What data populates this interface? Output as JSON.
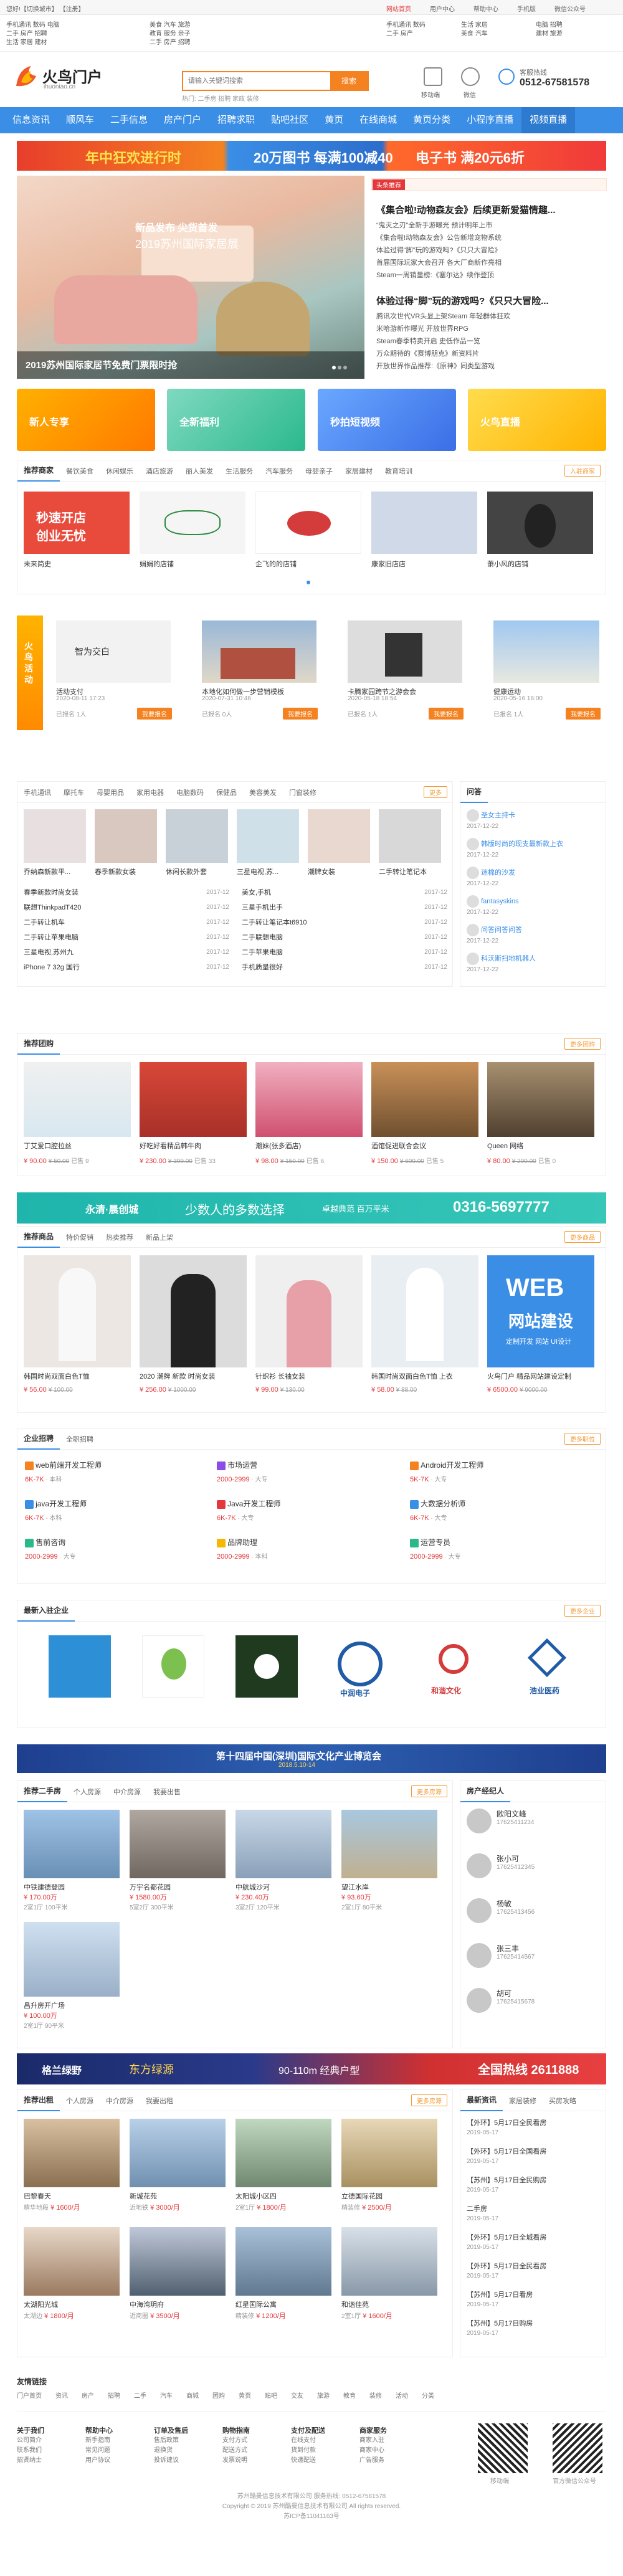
{
  "topbar": {
    "left": "您好!【切换城市】  【注册】",
    "right": [
      "网站首页",
      "用户中心",
      "帮助中心",
      "手机版",
      "微信公众号"
    ]
  },
  "header": {
    "cats": [
      [
        "手机通讯",
        "数码",
        "电脑"
      ],
      [
        "二手",
        "房产",
        "招聘"
      ],
      [
        "生活",
        "家居",
        "建材"
      ],
      [
        "美食",
        "汽车",
        "旅游"
      ],
      [
        "教育",
        "服务",
        "亲子"
      ]
    ],
    "cats2": [
      [
        "手机通讯",
        "数码",
        "电脑"
      ],
      [
        "二手",
        "房产",
        "招聘"
      ],
      [
        "生活",
        "家居",
        "建材"
      ],
      [
        "美食",
        "汽车",
        "旅游"
      ]
    ],
    "logo_text": "火鸟门户",
    "logo_sub": "ihuoniao.cn",
    "search_placeholder": "请输入关键词搜索",
    "search_button": "搜索",
    "search_tags": [
      "门店信息",
      "新闻公告",
      "招聘求职"
    ],
    "hot_words": "热门: 二手房 招聘 家政 装修",
    "icon_labels": [
      "移动端",
      "微信"
    ],
    "hotline_label": "客服热线",
    "hotline": "0512-67581578"
  },
  "nav": [
    "信息资讯",
    "顺风车",
    "二手信息",
    "房产门户",
    "招聘求职",
    "贴吧社区",
    "黄页",
    "在线商城",
    "黄页分类",
    "小程序直播",
    "视频直播"
  ],
  "banner": {
    "left": "年中狂欢进行时",
    "mid": "20万图书 每满100减40",
    "right": "电子书 满20元6折"
  },
  "hero": {
    "title": "2019苏州国际家居节免费门票限时抢",
    "sub": "2019苏州国际家居展",
    "ad": "新品发布 尖货首发"
  },
  "news": {
    "badge": "头条推荐",
    "headline": "《集合啦!动物森友会》后续更新爱猫情趣...",
    "lines": [
      "“鬼灭之刃”全新手游曝光 预计明年上市",
      "《集合啦!动物森友会》公告新增宠物系统",
      "体验过得“脚”玩的游戏吗?《只只大冒险》",
      "首届国际玩家大会召开 各大厂商新作亮相",
      "Steam一周销量榜:《塞尔达》续作登顶"
    ],
    "headline2": "体验过得“脚”玩的游戏吗?《只只大冒险...",
    "lines2": [
      "腾讯次世代VR头显上架Steam 年轻群体狂欢",
      "米哈游新作曝光 开放世界RPG",
      "Steam春季特卖开启 史低作品一览",
      "万众期待的《赛博朋克》新资料片",
      "开放世界作品推荐:《原神》同类型游戏"
    ]
  },
  "tiles": [
    {
      "label": "新人专享",
      "sub": "好礼包"
    },
    {
      "label": "全新福利",
      "sub": ""
    },
    {
      "label": "秒拍短视频",
      "sub": ""
    },
    {
      "label": "火鸟直播",
      "sub": ""
    }
  ],
  "shops": {
    "title": "推荐商家",
    "tabs": [
      "餐饮美食",
      "休闲娱乐",
      "酒店旅游",
      "丽人美发",
      "生活服务",
      "汽车服务",
      "母婴亲子",
      "家居建材",
      "教育培训"
    ],
    "more": "入驻商家",
    "items": [
      "未来简史",
      "娟娟的店铺",
      "企飞的的店铺",
      "康家旧店店",
      "萧小风的店铺"
    ]
  },
  "huodong": {
    "label": "火鸟活动",
    "items": [
      {
        "t": "活动支付",
        "d": "2020-08-11 17:23",
        "n": "已报名 1人"
      },
      {
        "t": "本地化如何做一步营销模板",
        "d": "2020-07-31 10:46",
        "n": "已报名 0人"
      },
      {
        "t": "卡腾家园跨节之游会会",
        "d": "2020-05-18 18:54",
        "n": "已报名 1人"
      },
      {
        "t": "健康运动",
        "d": "2020-05-16 16:00",
        "n": "已报名 1人"
      }
    ],
    "btn": "我要报名"
  },
  "twoc": {
    "tabs": [
      "手机通讯",
      "摩托车",
      "母婴用品",
      "家用电器",
      "电脑数码",
      "保健品",
      "美容美发",
      "门窗装修"
    ],
    "more": "更多",
    "thumbs": [
      "乔纳森新款平...",
      "春季新款女装",
      "休闲长款外套",
      "三星电视,苏...",
      "潮牌女装",
      "二手转让笔记本"
    ],
    "lista": [
      "春季新款时尚女装",
      "联想ThinkpadT420",
      "二手转让机车",
      "二手转让苹果电脑",
      "三星电视,苏州九",
      "iPhone 7 32g 国行"
    ],
    "listb": [
      "美女,手机",
      "三星手机出手",
      "二手转让笔记本t6910",
      "二手联想电脑",
      "二手苹果电脑",
      "手机质量很好"
    ],
    "dates": [
      "2017-12",
      "2017-12",
      "2017-12",
      "2017-12",
      "2017-12",
      "2017-12"
    ],
    "qa_title": "问答",
    "qa": [
      "圣女主持卡",
      "韩版时尚的现支最新款上衣",
      "迷棉的沙发",
      "fantasyskins",
      "问答问答问答",
      "科沃斯扫地机器人"
    ],
    "qa_date": "2017-12-22"
  },
  "group": {
    "title": "推荐团购",
    "more": "更多团购",
    "items": [
      {
        "t": "丁艾爱口腔拉丝",
        "p": "¥ 90.00",
        "o": "¥ 50.00",
        "n": "已售 9"
      },
      {
        "t": "好吃好看精品韩牛肉",
        "p": "¥ 230.00",
        "o": "¥ 399.00",
        "n": "已售 33"
      },
      {
        "t": "潮妹(张多酒店)",
        "p": "¥ 98.00",
        "o": "¥ 150.00",
        "n": "已售 6"
      },
      {
        "t": "酒馆促进联合会议",
        "p": "¥ 150.00",
        "o": "¥ 600.00",
        "n": "已售 5"
      },
      {
        "t": "Queen 网络",
        "p": "¥ 80.00",
        "o": "¥ 200.00",
        "n": "已售 0"
      }
    ]
  },
  "adbar": {
    "a": "永清·晨创城",
    "b": "少数人的多数选择",
    "c": "卓越典范 百万平米",
    "d": "0316-5697777"
  },
  "goods": {
    "tabs": [
      "推荐商品",
      "特价促销",
      "热卖推荐",
      "新品上架"
    ],
    "more": "更多商品",
    "items": [
      {
        "t": "韩国时尚双面白色T恤",
        "p": "¥ 56.00",
        "o": "¥ 100.00"
      },
      {
        "t": "2020 潮牌 新款 时尚女装",
        "p": "¥ 256.00",
        "o": "¥ 1000.00"
      },
      {
        "t": "针织衫 长袖女装",
        "p": "¥ 99.00",
        "o": "¥ 130.00"
      },
      {
        "t": "韩国时尚双面白色T恤 上衣",
        "p": "¥ 58.00",
        "o": "¥ 88.00"
      }
    ],
    "web": "WEB",
    "web2": "网站建设",
    "web3": "定制开发 网站 UI设计",
    "web_t": "火鸟门户 精品网站建设定制",
    "web_p": "¥ 6500.00",
    "web_o": "¥ 9000.00"
  },
  "jobs": {
    "tabs": [
      "企业招聘",
      "全职招聘"
    ],
    "more": "更多职位",
    "items": [
      {
        "t": "web前端开发工程师",
        "s": "6K-7K",
        "l": "本科"
      },
      {
        "t": "市场运营",
        "s": "2000-2999",
        "l": "大专"
      },
      {
        "t": "Android开发工程师",
        "s": "5K-7K",
        "l": "大专"
      },
      {
        "t": "java开发工程师",
        "s": "6K-7K",
        "l": "本科"
      },
      {
        "t": "Java开发工程师",
        "s": "6K-7K",
        "l": "大专"
      },
      {
        "t": "大数据分析师",
        "s": "6K-7K",
        "l": "大专"
      },
      {
        "t": "售前咨询",
        "s": "2000-2999",
        "l": "大专"
      },
      {
        "t": "品牌助理",
        "s": "2000-2999",
        "l": "本科"
      },
      {
        "t": "运营专员",
        "s": "2000-2999",
        "l": "大专"
      }
    ]
  },
  "companies": {
    "title": "最新入驻企业",
    "more": "更多企业",
    "items": [
      "中润电子",
      "ZOOMIND",
      "CBEC",
      "和谐文化",
      "浩业医药",
      "中润"
    ]
  },
  "banner2": {
    "t": "第十四届中国(深圳)国际文化产业博览会",
    "d": "2018.5.10-14"
  },
  "house": {
    "tabs": [
      "推荐二手房",
      "个人房源",
      "中介房源",
      "我要出售"
    ],
    "more": "更多房源",
    "items": [
      {
        "t": "中铁建德登园",
        "p": "¥ 170.00万",
        "a": "2室1厅 100平米"
      },
      {
        "t": "万宇名都花园",
        "p": "¥ 1580.00万",
        "a": "5室2厅 300平米"
      },
      {
        "t": "中航城沙河",
        "p": "¥ 230.40万",
        "a": "3室2厅 120平米"
      },
      {
        "t": "望江水岸",
        "p": "¥ 93.60万",
        "a": "2室1厅 80平米"
      },
      {
        "t": "昌升房开广场",
        "p": "¥ 100.00万",
        "a": "2室1厅 90平米"
      }
    ],
    "agent_title": "房产经纪人",
    "agents": [
      "欧阳文峰",
      "张小可",
      "杨敏",
      "张三丰",
      "胡可"
    ],
    "agent_phones": [
      "17625411234",
      "17625412345",
      "17625413456",
      "17625414567",
      "17625415678"
    ]
  },
  "banner3": {
    "a": "格兰绿野",
    "b": "东方绿源",
    "c": "90-110m 经典户型",
    "d": "全国热线 2611888"
  },
  "rent": {
    "tabs": [
      "推荐出租",
      "个人房源",
      "中介房源",
      "我要出租"
    ],
    "more": "更多房源",
    "items": [
      {
        "t": "巴黎春天",
        "p": "¥ 1600/月",
        "a": "精华地段"
      },
      {
        "t": "新城花苑",
        "p": "¥ 3000/月",
        "a": "近地铁"
      },
      {
        "t": "太阳城小区四",
        "p": "¥ 1800/月",
        "a": "2室1厅"
      },
      {
        "t": "立德国际花园",
        "p": "¥ 2500/月",
        "a": "精装修"
      },
      {
        "t": "太湖阳光城",
        "p": "¥ 1800/月",
        "a": "太湖边"
      },
      {
        "t": "中海湾玥府",
        "p": "¥ 3500/月",
        "a": "近商圈"
      },
      {
        "t": "红星国际公寓",
        "p": "¥ 1200/月",
        "a": "精装修"
      },
      {
        "t": "和谐佳苑",
        "p": "¥ 1600/月",
        "a": "2室1厅"
      }
    ],
    "news_tabs": [
      "最新资讯",
      "家居装修",
      "买房攻略"
    ],
    "news": [
      "【外环】5月17日全民看房",
      "【外环】5月17日全国看房",
      "【苏州】5月17日全民购房",
      "二手房",
      "【外环】5月17日全城看房",
      "【外环】5月17日全民看房",
      "【苏州】5月17日看房",
      "【苏州】5月17日购房"
    ],
    "news_date": "2019-05-17"
  },
  "links": {
    "title": "友情链接",
    "items": [
      "门户首页",
      "资讯",
      "房产",
      "招聘",
      "二手",
      "汽车",
      "商城",
      "团购",
      "黄页",
      "贴吧",
      "交友",
      "旅游",
      "教育",
      "装修",
      "活动",
      "分类"
    ]
  },
  "footer": {
    "cols": [
      {
        "h": "关于我们",
        "i": [
          "公司简介",
          "联系我们",
          "招贤纳士"
        ]
      },
      {
        "h": "帮助中心",
        "i": [
          "新手指南",
          "常见问题",
          "用户协议"
        ]
      },
      {
        "h": "订单及售后",
        "i": [
          "售后政策",
          "退换货",
          "投诉建议"
        ]
      },
      {
        "h": "购物指南",
        "i": [
          "支付方式",
          "配送方式",
          "发票说明"
        ]
      },
      {
        "h": "支付及配送",
        "i": [
          "在线支付",
          "货到付款",
          "快递配送"
        ]
      },
      {
        "h": "商家服务",
        "i": [
          "商家入驻",
          "商家中心",
          "广告服务"
        ]
      }
    ],
    "qr1": "移动端",
    "qr2": "官方微信公众号",
    "copy1": "苏州酷曼信息技术有限公司 服务热线: 0512-67581578",
    "copy2": "Copyright © 2019 苏州酷曼信息技术有限公司 All rights reserved.",
    "copy3": "苏ICP备11041163号"
  }
}
